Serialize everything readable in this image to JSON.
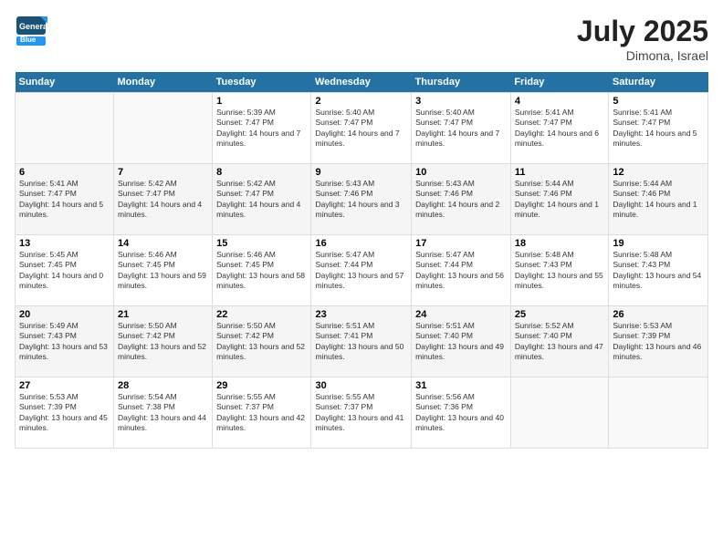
{
  "header": {
    "logo_line1": "General",
    "logo_line2": "Blue",
    "month": "July 2025",
    "location": "Dimona, Israel"
  },
  "weekdays": [
    "Sunday",
    "Monday",
    "Tuesday",
    "Wednesday",
    "Thursday",
    "Friday",
    "Saturday"
  ],
  "weeks": [
    [
      {
        "day": "",
        "info": ""
      },
      {
        "day": "",
        "info": ""
      },
      {
        "day": "1",
        "info": "Sunrise: 5:39 AM\nSunset: 7:47 PM\nDaylight: 14 hours and 7 minutes."
      },
      {
        "day": "2",
        "info": "Sunrise: 5:40 AM\nSunset: 7:47 PM\nDaylight: 14 hours and 7 minutes."
      },
      {
        "day": "3",
        "info": "Sunrise: 5:40 AM\nSunset: 7:47 PM\nDaylight: 14 hours and 7 minutes."
      },
      {
        "day": "4",
        "info": "Sunrise: 5:41 AM\nSunset: 7:47 PM\nDaylight: 14 hours and 6 minutes."
      },
      {
        "day": "5",
        "info": "Sunrise: 5:41 AM\nSunset: 7:47 PM\nDaylight: 14 hours and 5 minutes."
      }
    ],
    [
      {
        "day": "6",
        "info": "Sunrise: 5:41 AM\nSunset: 7:47 PM\nDaylight: 14 hours and 5 minutes."
      },
      {
        "day": "7",
        "info": "Sunrise: 5:42 AM\nSunset: 7:47 PM\nDaylight: 14 hours and 4 minutes."
      },
      {
        "day": "8",
        "info": "Sunrise: 5:42 AM\nSunset: 7:47 PM\nDaylight: 14 hours and 4 minutes."
      },
      {
        "day": "9",
        "info": "Sunrise: 5:43 AM\nSunset: 7:46 PM\nDaylight: 14 hours and 3 minutes."
      },
      {
        "day": "10",
        "info": "Sunrise: 5:43 AM\nSunset: 7:46 PM\nDaylight: 14 hours and 2 minutes."
      },
      {
        "day": "11",
        "info": "Sunrise: 5:44 AM\nSunset: 7:46 PM\nDaylight: 14 hours and 1 minute."
      },
      {
        "day": "12",
        "info": "Sunrise: 5:44 AM\nSunset: 7:46 PM\nDaylight: 14 hours and 1 minute."
      }
    ],
    [
      {
        "day": "13",
        "info": "Sunrise: 5:45 AM\nSunset: 7:45 PM\nDaylight: 14 hours and 0 minutes."
      },
      {
        "day": "14",
        "info": "Sunrise: 5:46 AM\nSunset: 7:45 PM\nDaylight: 13 hours and 59 minutes."
      },
      {
        "day": "15",
        "info": "Sunrise: 5:46 AM\nSunset: 7:45 PM\nDaylight: 13 hours and 58 minutes."
      },
      {
        "day": "16",
        "info": "Sunrise: 5:47 AM\nSunset: 7:44 PM\nDaylight: 13 hours and 57 minutes."
      },
      {
        "day": "17",
        "info": "Sunrise: 5:47 AM\nSunset: 7:44 PM\nDaylight: 13 hours and 56 minutes."
      },
      {
        "day": "18",
        "info": "Sunrise: 5:48 AM\nSunset: 7:43 PM\nDaylight: 13 hours and 55 minutes."
      },
      {
        "day": "19",
        "info": "Sunrise: 5:48 AM\nSunset: 7:43 PM\nDaylight: 13 hours and 54 minutes."
      }
    ],
    [
      {
        "day": "20",
        "info": "Sunrise: 5:49 AM\nSunset: 7:43 PM\nDaylight: 13 hours and 53 minutes."
      },
      {
        "day": "21",
        "info": "Sunrise: 5:50 AM\nSunset: 7:42 PM\nDaylight: 13 hours and 52 minutes."
      },
      {
        "day": "22",
        "info": "Sunrise: 5:50 AM\nSunset: 7:42 PM\nDaylight: 13 hours and 52 minutes."
      },
      {
        "day": "23",
        "info": "Sunrise: 5:51 AM\nSunset: 7:41 PM\nDaylight: 13 hours and 50 minutes."
      },
      {
        "day": "24",
        "info": "Sunrise: 5:51 AM\nSunset: 7:40 PM\nDaylight: 13 hours and 49 minutes."
      },
      {
        "day": "25",
        "info": "Sunrise: 5:52 AM\nSunset: 7:40 PM\nDaylight: 13 hours and 47 minutes."
      },
      {
        "day": "26",
        "info": "Sunrise: 5:53 AM\nSunset: 7:39 PM\nDaylight: 13 hours and 46 minutes."
      }
    ],
    [
      {
        "day": "27",
        "info": "Sunrise: 5:53 AM\nSunset: 7:39 PM\nDaylight: 13 hours and 45 minutes."
      },
      {
        "day": "28",
        "info": "Sunrise: 5:54 AM\nSunset: 7:38 PM\nDaylight: 13 hours and 44 minutes."
      },
      {
        "day": "29",
        "info": "Sunrise: 5:55 AM\nSunset: 7:37 PM\nDaylight: 13 hours and 42 minutes."
      },
      {
        "day": "30",
        "info": "Sunrise: 5:55 AM\nSunset: 7:37 PM\nDaylight: 13 hours and 41 minutes."
      },
      {
        "day": "31",
        "info": "Sunrise: 5:56 AM\nSunset: 7:36 PM\nDaylight: 13 hours and 40 minutes."
      },
      {
        "day": "",
        "info": ""
      },
      {
        "day": "",
        "info": ""
      }
    ]
  ]
}
